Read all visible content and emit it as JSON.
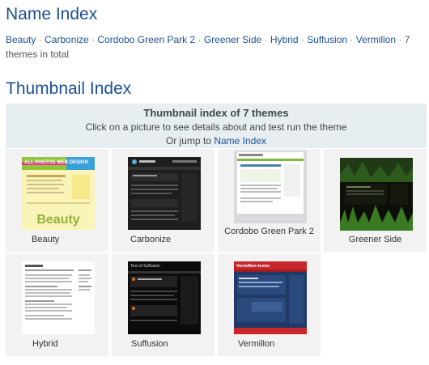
{
  "name_index": {
    "title": "Name Index",
    "themes": [
      "Beauty",
      "Carbonize",
      "Cordobo Green Park 2",
      "Greener Side",
      "Hybrid",
      "Suffusion",
      "Vermillon"
    ],
    "separator": " · ",
    "count_text": "7 themes in total"
  },
  "thumbnail_index": {
    "title": "Thumbnail Index",
    "header_title": "Thumbnail index of 7 themes",
    "header_help": "Click on a picture to see details about and test run the theme",
    "jump_prefix": "Or jump to",
    "jump_link": "Name Index",
    "items": [
      {
        "label": "Beauty",
        "thumb_text": "Beauty",
        "banner_text": "ALL PHOTOS WEB DESIGN",
        "accent": "#f7e24a"
      },
      {
        "label": "Carbonize",
        "thumb_text": "",
        "accent": "#2a2a2a"
      },
      {
        "label": "Cordobo Green Park 2",
        "thumb_text": "",
        "accent": "#7dbb3a"
      },
      {
        "label": "Greener Side",
        "thumb_text": "",
        "accent": "#1f3a14"
      },
      {
        "label": "Hybrid",
        "thumb_text": "",
        "accent": "#ffffff"
      },
      {
        "label": "Suffusion",
        "thumb_text": "Test of Suffusion",
        "accent": "#111111"
      },
      {
        "label": "Vermillon",
        "thumb_text": "Vermillon-tester",
        "accent": "#c8262b"
      }
    ]
  }
}
